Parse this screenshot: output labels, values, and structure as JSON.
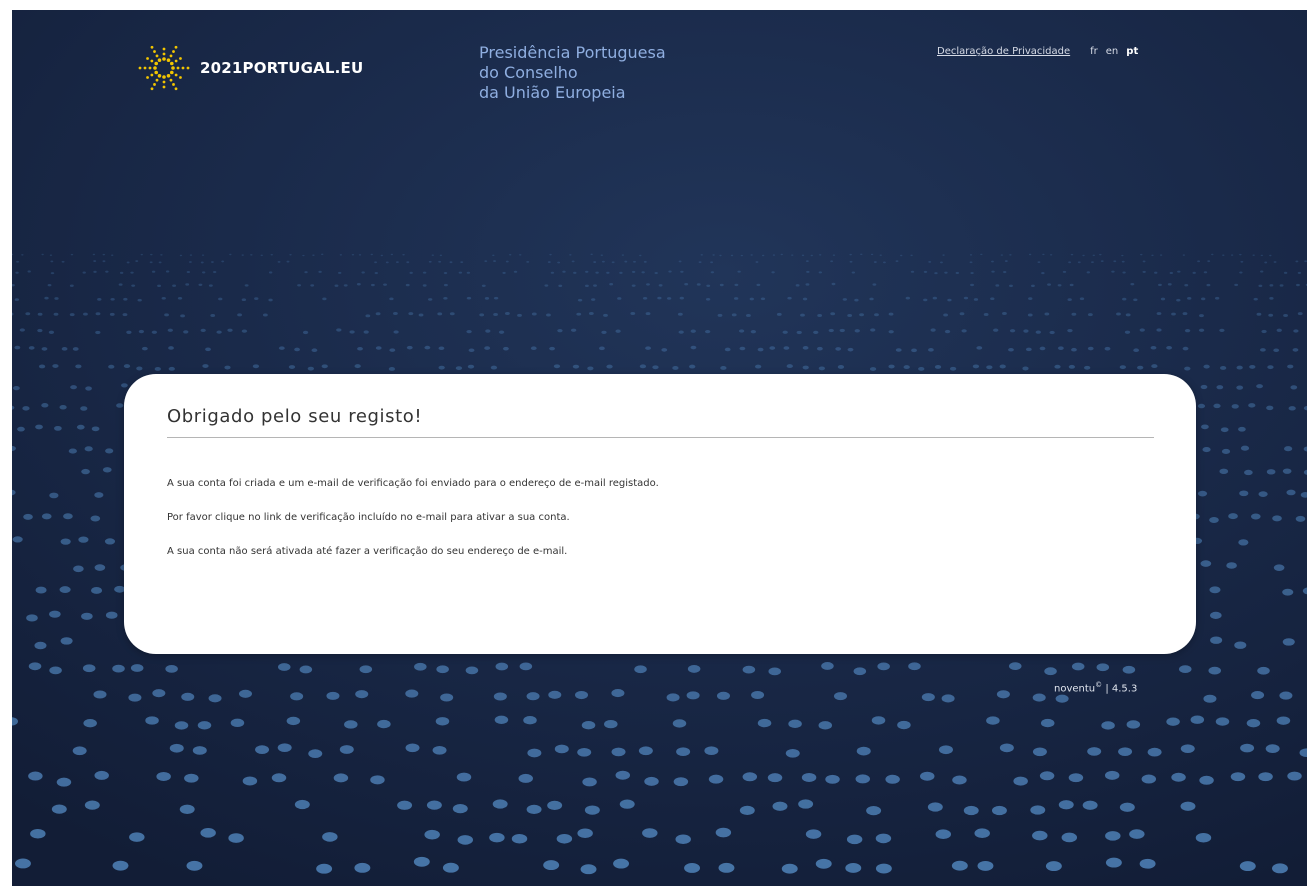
{
  "header": {
    "logo_text": "2021PORTUGAL.EU",
    "presidency_lines": [
      "Presidência Portuguesa",
      "do Conselho",
      "da União Europeia"
    ],
    "privacy_link": "Declaração de Privacidade",
    "languages": [
      "fr",
      "en",
      "pt"
    ],
    "active_language": "pt"
  },
  "card": {
    "title": "Obrigado pelo seu registo!",
    "paragraphs": [
      "A sua conta foi criada e um e-mail de verificação foi enviado para o endereço de e-mail registado.",
      "Por favor clique no link de verificação incluído no e-mail para ativar a sua conta.",
      "A sua conta não será ativada até fazer a verificação do seu endereço de e-mail."
    ]
  },
  "footer": {
    "brand": "noventu",
    "copyright_mark": "©",
    "version": "| 4.5.3"
  },
  "colors": {
    "background": "#1a2a4a",
    "dots": "#4d7fb5",
    "logo_star": "#f2c500",
    "presidency_text": "#8faee0"
  },
  "icons": {
    "logo": "sun-star-logo-icon"
  }
}
